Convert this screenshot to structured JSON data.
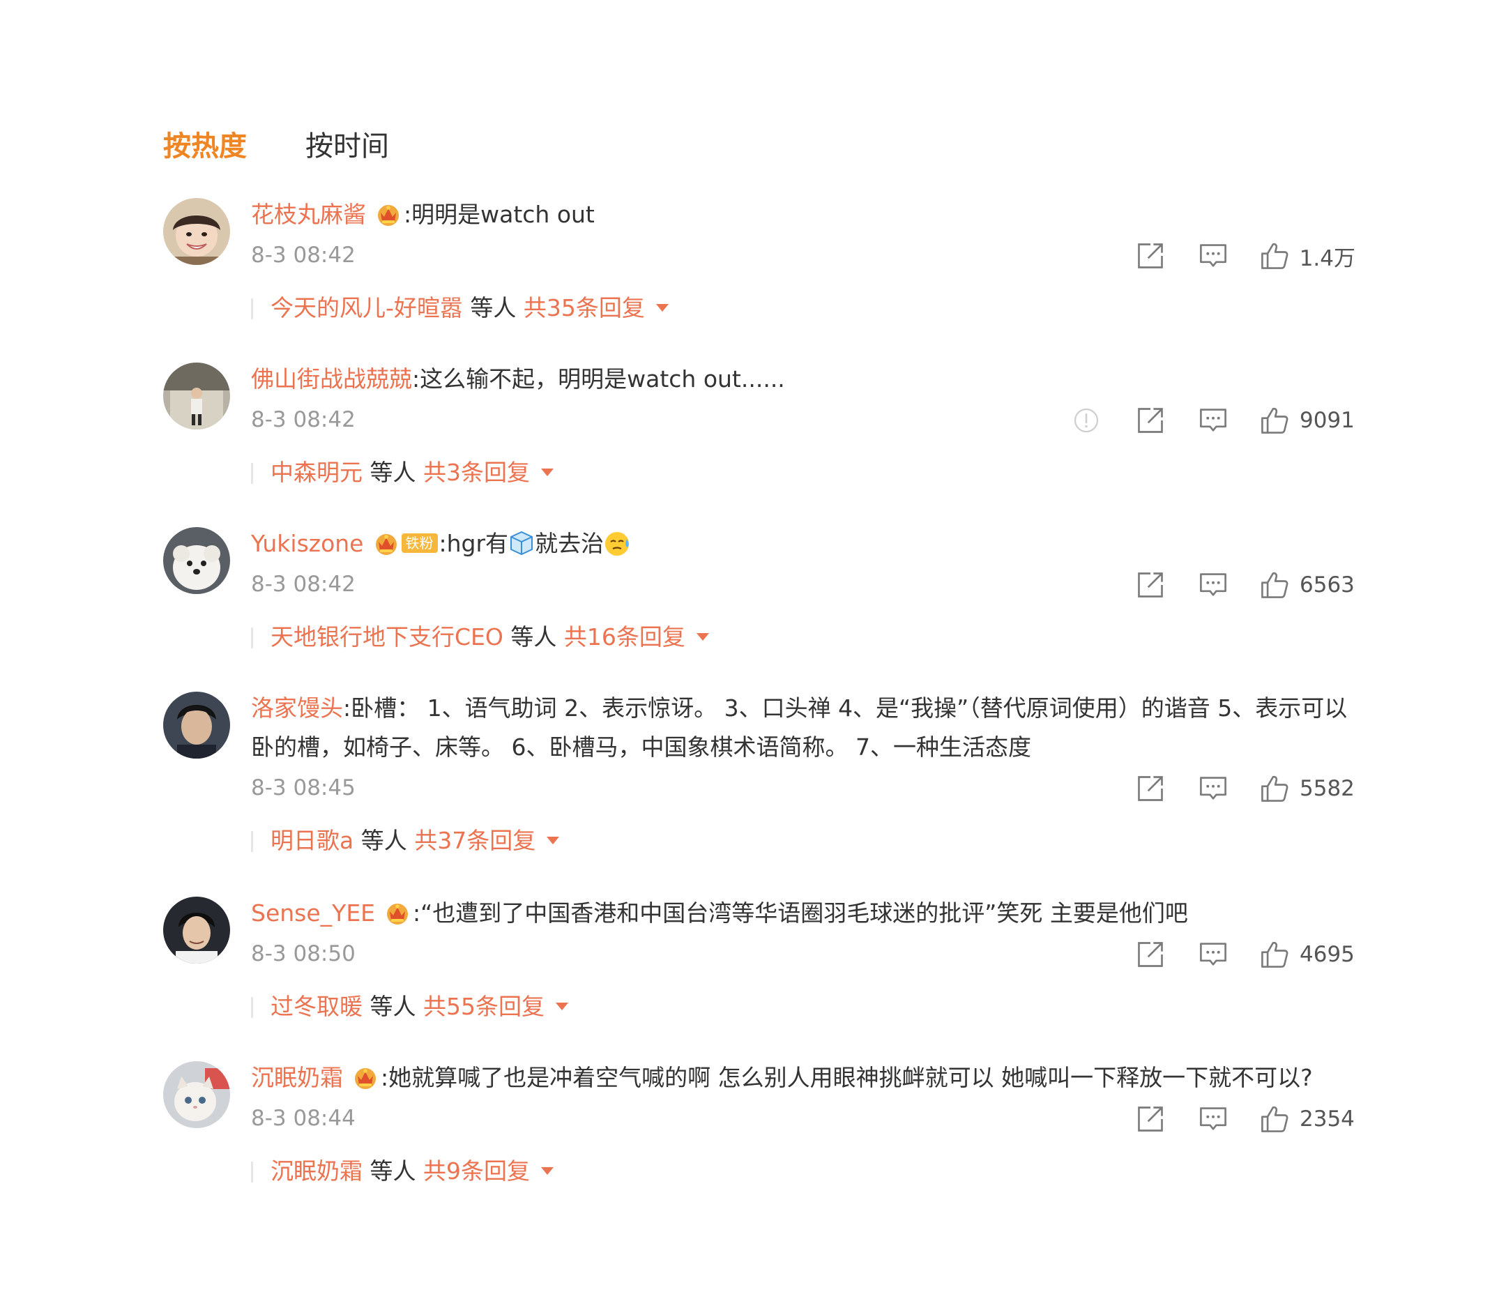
{
  "tabs": {
    "hot": "按热度",
    "time": "按时间"
  },
  "colors": {
    "accent": "#f08524",
    "username": "#eb7350",
    "meta": "#999999"
  },
  "comments": [
    {
      "user": "花枝丸麻酱",
      "badge": "crown-badge-icon",
      "text": ":明明是watch out",
      "time": "8-3 08:42",
      "likes": "1.4万",
      "reply_user": "今天的风儿-好暄嚣",
      "reply_mid": " 等人 ",
      "reply_count": "共35条回复"
    },
    {
      "user": "佛山街战战兢兢",
      "text": ":这么输不起，明明是watch out......",
      "time": "8-3 08:42",
      "likes": "9091",
      "reply_user": "中森明元",
      "reply_mid": " 等人 ",
      "reply_count": "共3条回复"
    },
    {
      "user": "Yukiszone",
      "badge": "crown-badge-icon",
      "fan_tag": "铁粉",
      "text_a": ":hgr有",
      "text_b": "就去治",
      "emoji_1": "ice-cube-icon",
      "emoji_2": "sweat-face-icon",
      "time": "8-3 08:42",
      "likes": "6563",
      "reply_user": "天地银行地下支行CEO",
      "reply_mid": " 等人 ",
      "reply_count": "共16条回复"
    },
    {
      "user": "洛家馒头",
      "text": ":卧槽： 1、语气助词 2、表示惊讶。 3、口头禅 4、是“我操”（替代原词使用）的谐音 5、表示可以卧的槽，如椅子、床等。 6、卧槽马，中国象棋术语简称。 7、一种生活态度",
      "time": "8-3 08:45",
      "likes": "5582",
      "reply_user": "明日歌a",
      "reply_mid": " 等人 ",
      "reply_count": "共37条回复"
    },
    {
      "user": "Sense_YEE",
      "badge": "crown-badge-icon",
      "text": ":“也遭到了中国香港和中国台湾等华语圈羽毛球迷的批评”笑死 主要是他们吧",
      "time": "8-3 08:50",
      "likes": "4695",
      "reply_user": "过冬取暖",
      "reply_mid": " 等人 ",
      "reply_count": "共55条回复"
    },
    {
      "user": "沉眠奶霜",
      "badge": "crown-badge-icon",
      "text": ":她就算喊了也是冲着空气喊的啊 怎么别人用眼神挑衅就可以 她喊叫一下释放一下就不可以?",
      "time": "8-3 08:44",
      "likes": "2354",
      "reply_user": "沉眠奶霜",
      "reply_mid": " 等人 ",
      "reply_count": "共9条回复"
    }
  ]
}
